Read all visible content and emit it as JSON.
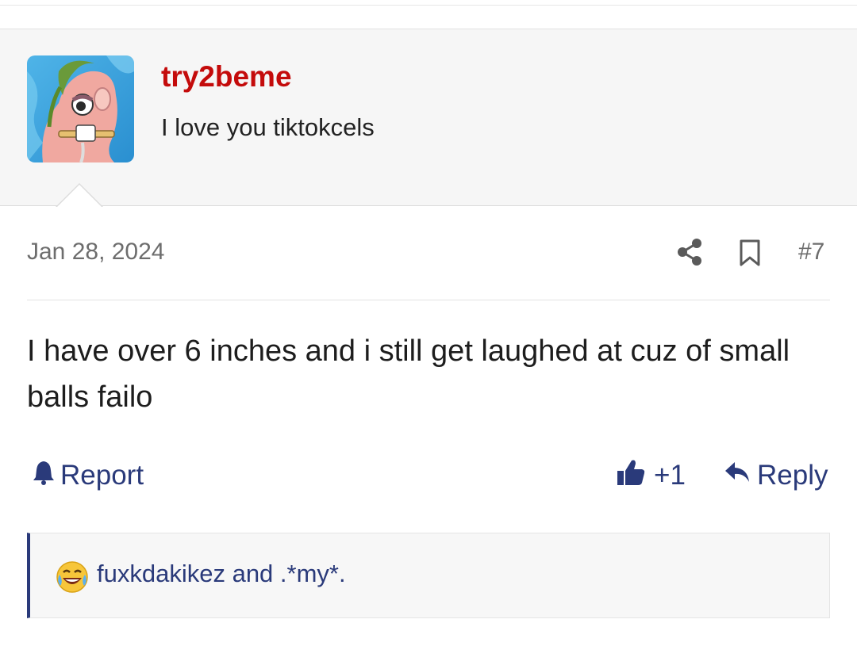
{
  "user": {
    "name": "try2beme",
    "title": "I love you tiktokcels",
    "name_color": "#c40b0b"
  },
  "post": {
    "date": "Jan 28, 2024",
    "number": "#7",
    "body": "I have over 6 inches and i still get laughed at cuz of small balls failo",
    "icons": [
      "share-icon",
      "bookmark-icon"
    ]
  },
  "actions": {
    "report_label": "Report",
    "like_count": "+1",
    "reply_label": "Reply",
    "link_color": "#2a3a7a"
  },
  "reactions": {
    "emoji": "laughing-crying-emoji",
    "text": "fuxkdakikez and .*my*."
  }
}
